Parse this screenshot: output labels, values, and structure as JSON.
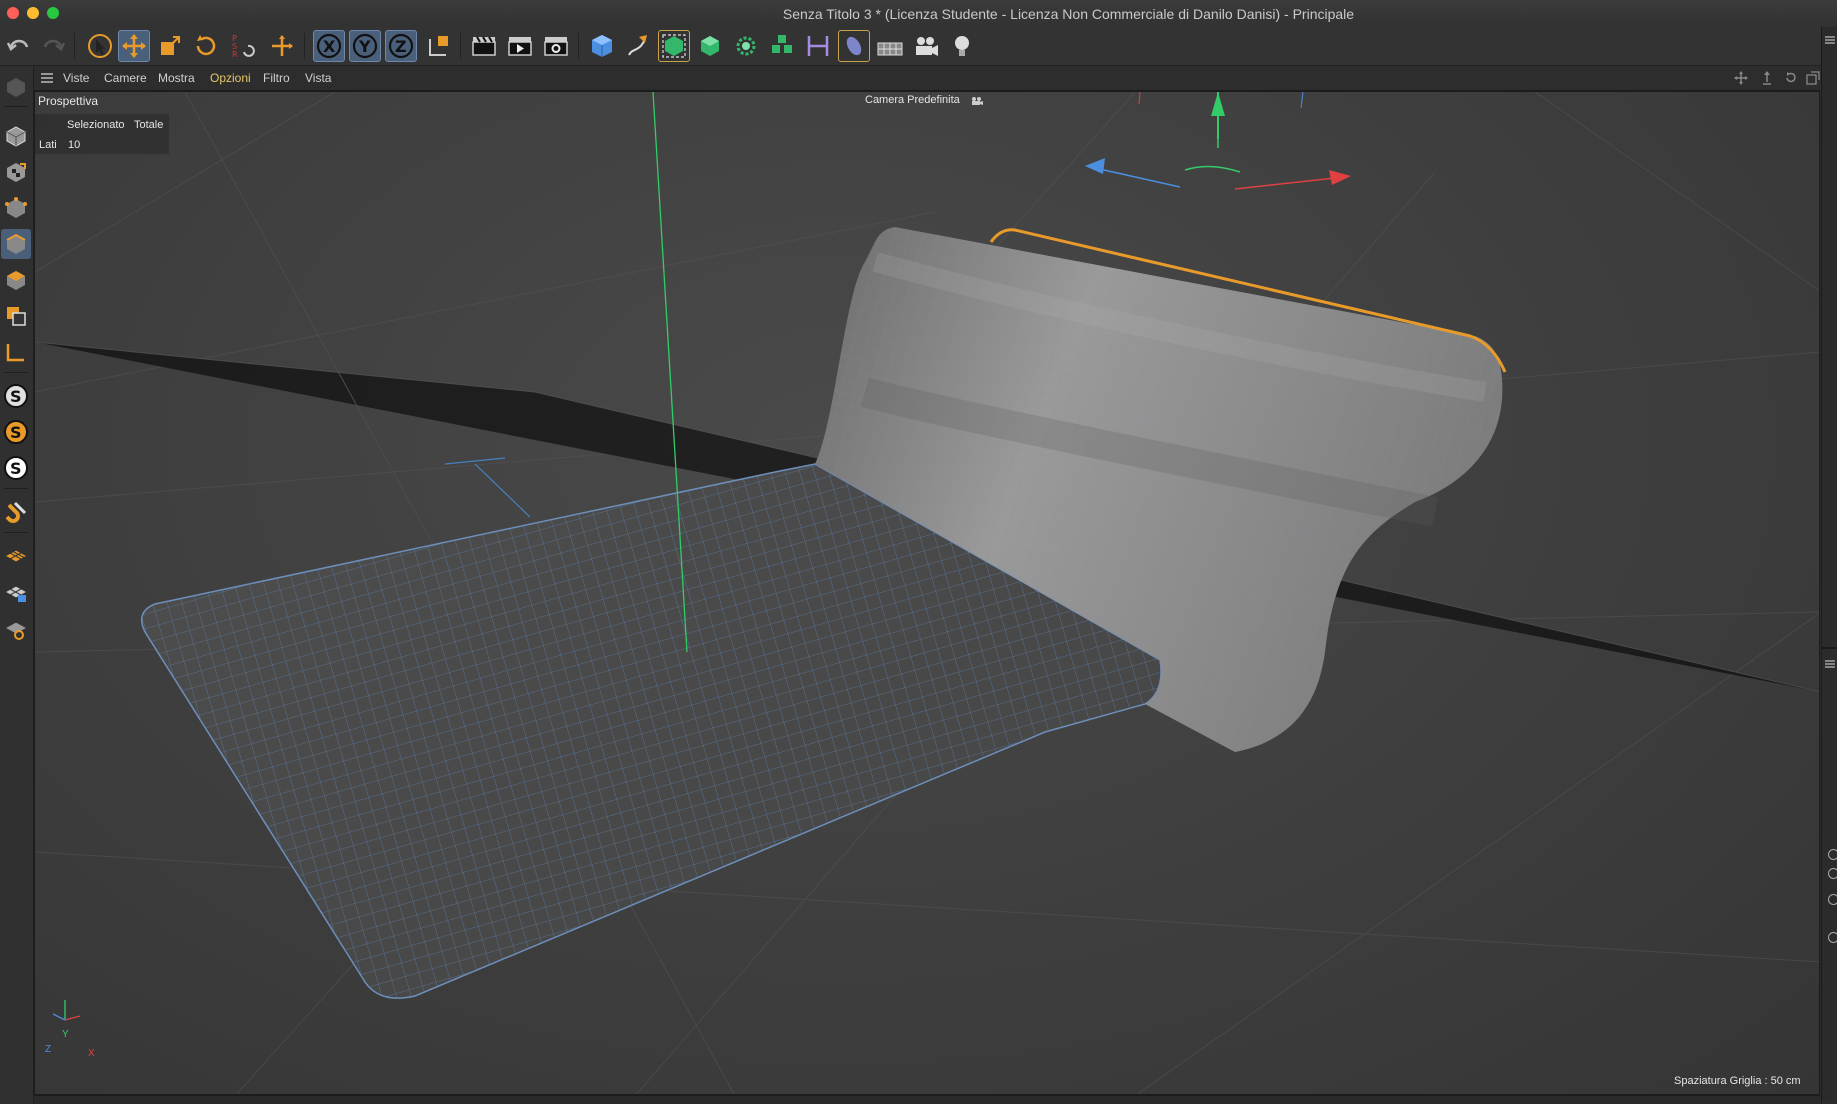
{
  "window": {
    "title": "Senza Titolo 3 * (Licenza Studente - Licenza Non Commerciale di Danilo Danisi) - Principale"
  },
  "menu": {
    "items": [
      "Viste",
      "Camere",
      "Mostra",
      "Opzioni",
      "Filtro",
      "Vista"
    ]
  },
  "viewport": {
    "view_name": "Prospettiva",
    "camera_name": "Camera Predefinita",
    "hud": {
      "col_selected": "Selezionato",
      "col_total": "Totale",
      "row_label": "Lati",
      "row_value": "10"
    },
    "grid_spacing": "Spaziatura Griglia : 50 cm",
    "axis_labels": {
      "x": "X",
      "y": "Y",
      "z": "Z"
    }
  },
  "toolbar": {
    "axis_x": "X",
    "axis_y": "Y",
    "axis_z": "Z"
  },
  "leftbar": {
    "snap_glyph": "S"
  },
  "colors": {
    "accent_orange": "#e89b2b",
    "active_blue": "#4a5f7a",
    "mesh_wire": "#5d7fa8",
    "axis_x": "#e04040",
    "axis_y": "#33cc66",
    "axis_z": "#4a8fe0"
  }
}
